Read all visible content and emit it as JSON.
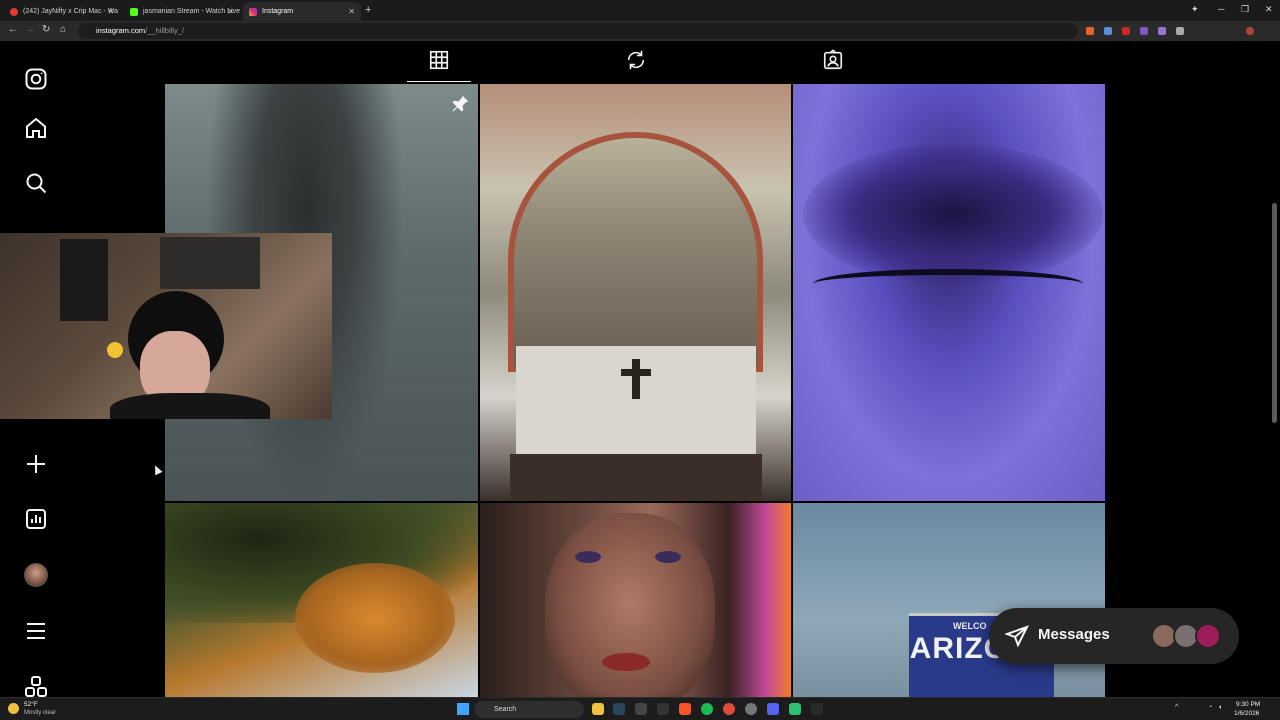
{
  "browser": {
    "tabs": [
      {
        "label": "(242) JayNifty x Crip Mac - Wa",
        "color": "#e53935",
        "active": false
      },
      {
        "label": "jasmanian Stream - Watch Live",
        "color": "#53fc18",
        "active": false
      },
      {
        "label": "Instagram",
        "color": "#e1306c",
        "active": true
      }
    ],
    "new_tab_glyph": "+",
    "window_controls": {
      "sparkle": "✦",
      "minimize": "─",
      "restore": "❐",
      "close": "✕"
    },
    "url_prefix": "instagram.com",
    "url_path": "/__hillbilly_/"
  },
  "sidebar": {
    "items": [
      {
        "name": "instagram-logo-icon"
      },
      {
        "name": "home-icon"
      },
      {
        "name": "search-icon"
      },
      {
        "name": "create-icon"
      },
      {
        "name": "insights-icon"
      },
      {
        "name": "profile-avatar"
      },
      {
        "name": "more-menu-icon"
      },
      {
        "name": "also-from-meta-icon"
      }
    ]
  },
  "profile_tabs": [
    {
      "name": "posts",
      "icon": "grid-icon",
      "active": true
    },
    {
      "name": "reels",
      "icon": "reels-icon",
      "active": false
    },
    {
      "name": "tagged",
      "icon": "tagged-icon",
      "active": false
    }
  ],
  "posts": {
    "pinned_icon": "pin-icon",
    "tile6_sign_top": "WELCO",
    "tile6_sign_main": "ARIZONA"
  },
  "messages": {
    "label": "Messages",
    "avatar_colors": [
      "#8a6a5a",
      "#7a7070",
      "#9b1d5a"
    ]
  },
  "taskbar": {
    "weather_temp": "52°F",
    "weather_desc": "Mostly clear",
    "search_placeholder": "Search",
    "time": "9:30 PM",
    "date": "1/6/2026"
  }
}
